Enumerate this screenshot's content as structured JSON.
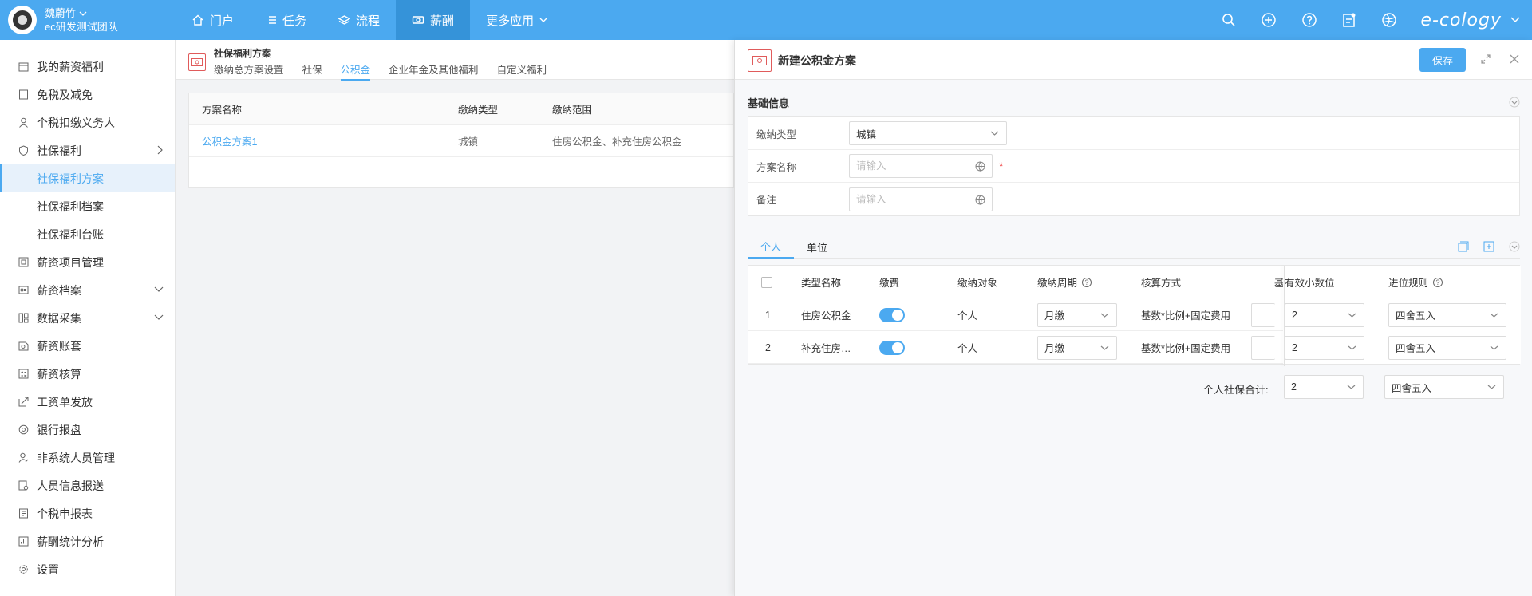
{
  "user": {
    "name": "魏蔚竹",
    "team": "ec研发测试团队"
  },
  "nav": [
    {
      "label": "门户",
      "icon": "home-icon"
    },
    {
      "label": "任务",
      "icon": "list-icon"
    },
    {
      "label": "流程",
      "icon": "layers-icon"
    },
    {
      "label": "薪酬",
      "icon": "money-icon"
    },
    {
      "label": "更多应用",
      "icon": "chevron-down-icon"
    }
  ],
  "brand": "e-cology",
  "sidebar": {
    "items": [
      {
        "label": "我的薪资福利",
        "icon": "wallet-icon"
      },
      {
        "label": "免税及减免",
        "icon": "document-icon"
      },
      {
        "label": "个税扣缴义务人",
        "icon": "person-icon"
      },
      {
        "label": "社保福利",
        "icon": "shield-icon"
      },
      {
        "label": "社保福利方案"
      },
      {
        "label": "社保福利档案"
      },
      {
        "label": "社保福利台账"
      },
      {
        "label": "薪资项目管理",
        "icon": "copy-icon"
      },
      {
        "label": "薪资档案",
        "icon": "archive-icon"
      },
      {
        "label": "数据采集",
        "icon": "grid-icon"
      },
      {
        "label": "薪资账套",
        "icon": "book-icon"
      },
      {
        "label": "薪资核算",
        "icon": "calc-icon"
      },
      {
        "label": "工资单发放",
        "icon": "send-icon"
      },
      {
        "label": "银行报盘",
        "icon": "at-icon"
      },
      {
        "label": "非系统人员管理",
        "icon": "user-edit-icon"
      },
      {
        "label": "人员信息报送",
        "icon": "report-icon"
      },
      {
        "label": "个税申报表",
        "icon": "tax-icon"
      },
      {
        "label": "薪酬统计分析",
        "icon": "chart-icon"
      },
      {
        "label": "设置",
        "icon": "gear-icon"
      }
    ]
  },
  "middle": {
    "title": "社保福利方案",
    "tabs": [
      "缴纳总方案设置",
      "社保",
      "公积金",
      "企业年金及其他福利",
      "自定义福利"
    ],
    "active_tab": "公积金",
    "table": {
      "headers": [
        "方案名称",
        "缴纳类型",
        "缴纳范围"
      ],
      "rows": [
        [
          "公积金方案1",
          "城镇",
          "住房公积金、补充住房公积金"
        ]
      ]
    }
  },
  "drawer": {
    "title": "新建公积金方案",
    "save_label": "保存",
    "section_title": "基础信息",
    "form": {
      "pay_type_label": "缴纳类型",
      "pay_type_value": "城镇",
      "plan_name_label": "方案名称",
      "plan_name_placeholder": "请输入",
      "remark_label": "备注",
      "remark_placeholder": "请输入",
      "required_mark": "*"
    },
    "tabs": [
      "个人",
      "单位"
    ],
    "active_tab": "个人",
    "table": {
      "headers": [
        "类型名称",
        "缴费",
        "缴纳对象",
        "缴纳周期",
        "核算方式",
        "基",
        "有效小数位",
        "进位规则"
      ],
      "rows": [
        {
          "index": "1",
          "name": "住房公积金",
          "enabled": true,
          "target": "个人",
          "cycle": "月缴",
          "method": "基数*比例+固定费用",
          "decimals": "2",
          "rounding": "四舍五入"
        },
        {
          "index": "2",
          "name": "补充住房…",
          "enabled": true,
          "target": "个人",
          "cycle": "月缴",
          "method": "基数*比例+固定费用",
          "decimals": "2",
          "rounding": "四舍五入"
        }
      ]
    },
    "summary_label": "个人社保合计:",
    "summary_decimals": "2",
    "summary_rounding": "四舍五入"
  },
  "colors": {
    "accent": "#4ba9f0",
    "topbar": "#4ba9f0",
    "required": "#f04848"
  }
}
